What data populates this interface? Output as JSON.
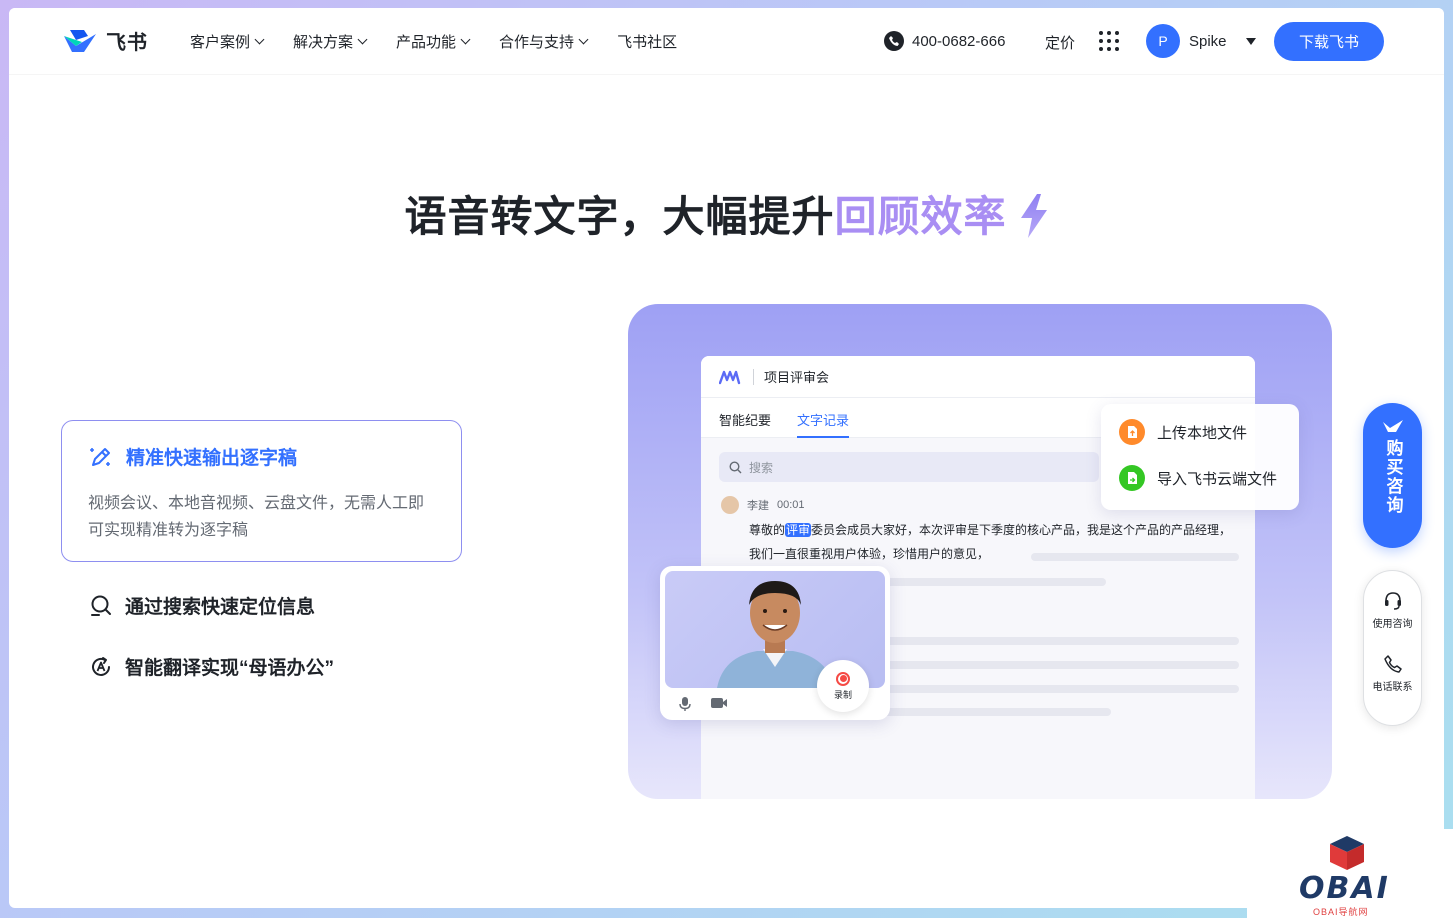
{
  "nav": {
    "logo_text": "飞书",
    "menu": [
      {
        "label": "客户案例",
        "has_dropdown": true
      },
      {
        "label": "解决方案",
        "has_dropdown": true
      },
      {
        "label": "产品功能",
        "has_dropdown": true
      },
      {
        "label": "合作与支持",
        "has_dropdown": true
      },
      {
        "label": "飞书社区",
        "has_dropdown": false
      }
    ],
    "phone": "400-0682-666",
    "pricing": "定价",
    "user_initial": "P",
    "user_name": "Spike",
    "download": "下载飞书"
  },
  "hero": {
    "title_main": "语音转文字，大幅提升",
    "title_highlight": "回顾效率"
  },
  "features": {
    "active": {
      "title": "精准快速输出逐字稿",
      "description": "视频会议、本地音视频、云盘文件，无需人工即可实现精准转为逐字稿"
    },
    "items": [
      {
        "title": "通过搜索快速定位信息"
      },
      {
        "title": "智能翻译实现“母语办公”"
      }
    ]
  },
  "demo": {
    "doc_title": "项目评审会",
    "tabs": [
      "智能纪要",
      "文字记录"
    ],
    "search_placeholder": "搜索",
    "speaker_name": "李建",
    "speaker_time": "00:01",
    "transcript_before": "尊敬的",
    "transcript_mark": "评审",
    "transcript_after": "委员会成员大家好，本次评审是下季度的核心产品，我是这个产品的产品经理，我们一直很重视用户体验，珍惜用户的意见，",
    "upload_local": "上传本地文件",
    "import_cloud": "导入飞书云端文件",
    "record_label": "录制"
  },
  "sidebar": {
    "buy": "购买咨询",
    "usage": "使用咨询",
    "phone": "电话联系"
  },
  "watermark": {
    "text": "OBAI",
    "sub": "OBAI导航网"
  },
  "colors": {
    "brand": "#3370ff",
    "highlight": "#a98ef3",
    "upload_orange": "#ff8a2b",
    "import_green": "#34c724",
    "record_red": "#f54a45"
  }
}
